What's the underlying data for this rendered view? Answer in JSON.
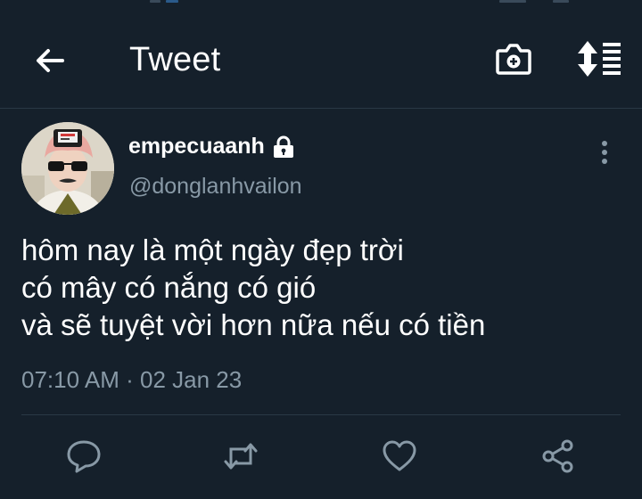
{
  "header": {
    "title": "Tweet",
    "back_icon": "arrow-left-icon",
    "camera_icon": "camera-add-icon",
    "sort_icon": "sort-updown-icon"
  },
  "tweet": {
    "display_name": "empecuaanh",
    "protected_icon": "lock-icon",
    "handle": "@donglanhvailon",
    "lines": [
      "hôm nay là một ngày đẹp trời",
      "có mây có nắng có gió",
      "và sẽ tuyệt vời hơn nữa nếu có tiền"
    ],
    "time": "07:10 AM",
    "date": "02 Jan 23"
  },
  "actions": {
    "reply_icon": "reply-icon",
    "retweet_icon": "retweet-icon",
    "like_icon": "heart-icon",
    "share_icon": "share-icon"
  },
  "colors": {
    "background": "#15202b",
    "text": "#ffffff",
    "secondary": "#8899a6",
    "divider": "#2a3845"
  }
}
